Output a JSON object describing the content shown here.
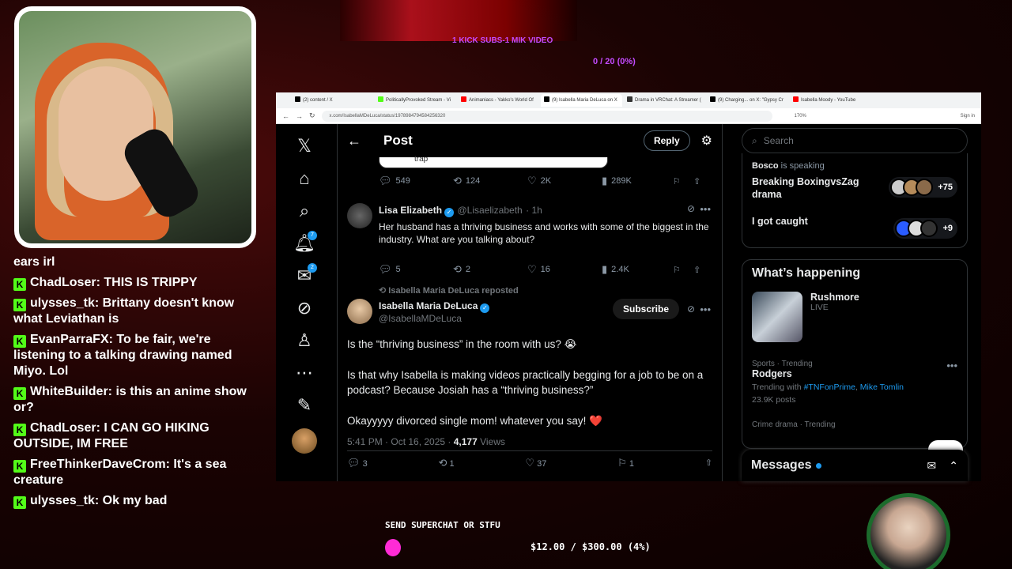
{
  "overlay": {
    "kick_goal": "1 KICK SUBS-1 MIK VIDEO",
    "sub_progress": "0 / 20 (0%)",
    "superchat_label": "SEND SUPERCHAT OR STFU",
    "superchat_progress": "$12.00 / $300.00 (4%)",
    "superchat_fraction": 0.04
  },
  "chat": [
    {
      "user": "",
      "text": "ears irl",
      "kick": false
    },
    {
      "user": "ChadLoser",
      "text": "THIS IS TRIPPY",
      "kick": true
    },
    {
      "user": "ulysses_tk",
      "text": "Brittany doesn't know what Leviathan is",
      "kick": true
    },
    {
      "user": "EvanParraFX",
      "text": "To be fair, we're listening to a talking drawing named Miyo. Lol",
      "kick": true
    },
    {
      "user": "WhiteBuilder",
      "text": "is this an anime show or?",
      "kick": true
    },
    {
      "user": "ChadLoser",
      "text": "I CAN GO HIKING OUTSIDE, IM FREE",
      "kick": true
    },
    {
      "user": "FreeThinkerDaveCrom",
      "text": "It's a sea creature",
      "kick": true
    },
    {
      "user": "ulysses_tk",
      "text": "Ok my bad",
      "kick": true
    }
  ],
  "browser": {
    "tabs": [
      {
        "label": "(2) content / X",
        "color": "#000000"
      },
      {
        "label": "PoliticallyProvoked Stream - Vi",
        "color": "#53fc18"
      },
      {
        "label": "Animaniacs - Yakko's World Of",
        "color": "#ff0000"
      },
      {
        "label": "(9) Isabella Maria DeLuca on X",
        "color": "#000000"
      },
      {
        "label": "Drama in VRChat: A Streamer (",
        "color": "#333333"
      },
      {
        "label": "(9) Charging... on X: \"Gypsy Cr",
        "color": "#000000"
      },
      {
        "label": "Isabella Moody - YouTube",
        "color": "#ff0000"
      }
    ],
    "url": "x.com/IsabellaMDeLuca/status/1978984794584256320",
    "zoom": "170%",
    "sign_in": "Sign in"
  },
  "x": {
    "nav_badges": {
      "notifications": "7",
      "messages": "2"
    },
    "header": {
      "title": "Post",
      "reply": "Reply"
    },
    "quote_tail": "trap",
    "top_actions": {
      "replies": "549",
      "reposts": "124",
      "likes": "2K",
      "views": "289K"
    },
    "reply_tweet": {
      "name": "Lisa Elizabeth",
      "handle": "@Lisaelizabeth",
      "time": "· 1h",
      "text": "Her husband has a thriving business and works with some of the biggest in the industry. What are you talking about?",
      "replies": "5",
      "reposts": "2",
      "likes": "16",
      "views": "2.4K"
    },
    "reposted_by": "Isabella Maria DeLuca reposted",
    "main_tweet": {
      "name": "Isabella Maria DeLuca",
      "handle": "@IsabellaMDeLuca",
      "subscribe": "Subscribe",
      "para1": "Is the “thriving business” in the room with us? 😭",
      "para2": "Is that why Isabella is making videos practically begging for a job to be on a podcast? Because Josiah has a “thriving business?”",
      "para3": "Okayyyyy divorced single mom!  whatever you say! ❤️",
      "time": "5:41 PM · Oct 16, 2025 · ",
      "views_count": "4,177",
      "views_label": " Views",
      "replies": "3",
      "reposts": "1",
      "likes": "37",
      "bookmarks": "1"
    },
    "search_placeholder": "Search",
    "spaces": [
      {
        "speaker": "Bosco",
        "speaking": " is speaking",
        "title": "Breaking BoxingvsZag drama",
        "extra": "+75"
      },
      {
        "title": "I got caught",
        "extra": "+9"
      }
    ],
    "happening": {
      "title": "What’s happening",
      "live_name": "Rushmore",
      "live_status": "LIVE",
      "trend1_meta": "Sports · Trending",
      "trend1_name": "Rodgers",
      "trend1_with": "Trending with ",
      "trend1_link1": "#TNFonPrime",
      "trend1_link2": "Mike Tomlin",
      "trend1_posts": "23.9K posts",
      "trend2_meta": "Crime drama · Trending"
    },
    "messages": "Messages"
  }
}
